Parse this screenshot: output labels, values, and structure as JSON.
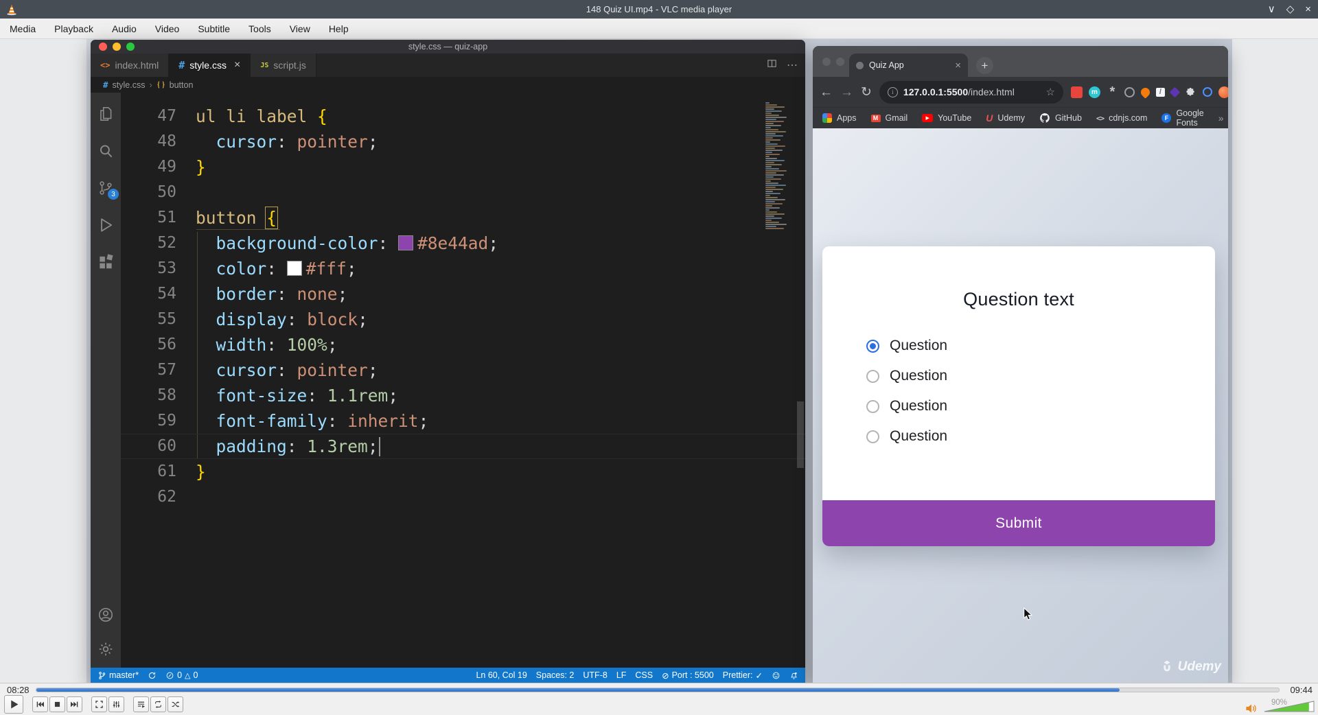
{
  "vlc": {
    "title": "148 Quiz UI.mp4 - VLC media player",
    "menu": [
      "Media",
      "Playback",
      "Audio",
      "Video",
      "Subtitle",
      "Tools",
      "View",
      "Help"
    ],
    "window_controls": [
      "minimize",
      "maximize",
      "close"
    ],
    "time_elapsed": "08:28",
    "time_total": "09:44",
    "progress_pct": 87.2,
    "volume_label": "90%",
    "volume_fill_pct": 90,
    "control_groups": [
      [
        "play"
      ],
      [
        "previous",
        "stop",
        "next"
      ],
      [
        "fullscreen",
        "equalizer"
      ],
      [
        "playlist",
        "loop",
        "shuffle"
      ]
    ]
  },
  "vscode": {
    "window_title": "style.css — quiz-app",
    "activity_bar": [
      "explorer",
      "search",
      "source-control",
      "run-debug",
      "extensions"
    ],
    "activity_bar_bottom": [
      "account",
      "settings"
    ],
    "scm_badge": "3",
    "tabs": [
      {
        "label": "index.html",
        "icon": "html",
        "active": false
      },
      {
        "label": "style.css",
        "icon": "css",
        "active": true
      },
      {
        "label": "script.js",
        "icon": "js",
        "active": false
      }
    ],
    "breadcrumb": {
      "file": "style.css",
      "symbol": "button"
    },
    "code": {
      "lines": [
        {
          "n": 47,
          "segments": [
            {
              "t": "ul li label ",
              "c": "sel"
            },
            {
              "t": "{",
              "c": "brace"
            }
          ]
        },
        {
          "n": 48,
          "segments": [
            {
              "t": "  ",
              "c": "pun"
            },
            {
              "t": "cursor",
              "c": "prop"
            },
            {
              "t": ": ",
              "c": "pun"
            },
            {
              "t": "pointer",
              "c": "val"
            },
            {
              "t": ";",
              "c": "pun"
            }
          ]
        },
        {
          "n": 49,
          "segments": [
            {
              "t": "}",
              "c": "brace"
            }
          ]
        },
        {
          "n": 50,
          "segments": []
        },
        {
          "n": 51,
          "segments": [
            {
              "t": "button ",
              "c": "sel"
            },
            {
              "t": "{",
              "c": "brace",
              "match": true
            }
          ]
        },
        {
          "n": 52,
          "segments": [
            {
              "t": "  ",
              "c": "pun"
            },
            {
              "t": "background-color",
              "c": "prop"
            },
            {
              "t": ": ",
              "c": "pun"
            },
            {
              "t": "#8e44ad",
              "c": "val",
              "swatch": "#8e44ad"
            },
            {
              "t": ";",
              "c": "pun"
            }
          ]
        },
        {
          "n": 53,
          "segments": [
            {
              "t": "  ",
              "c": "pun"
            },
            {
              "t": "color",
              "c": "prop"
            },
            {
              "t": ": ",
              "c": "pun"
            },
            {
              "t": "#fff",
              "c": "val",
              "swatch": "#ffffff"
            },
            {
              "t": ";",
              "c": "pun"
            }
          ]
        },
        {
          "n": 54,
          "segments": [
            {
              "t": "  ",
              "c": "pun"
            },
            {
              "t": "border",
              "c": "prop"
            },
            {
              "t": ": ",
              "c": "pun"
            },
            {
              "t": "none",
              "c": "val"
            },
            {
              "t": ";",
              "c": "pun"
            }
          ]
        },
        {
          "n": 55,
          "segments": [
            {
              "t": "  ",
              "c": "pun"
            },
            {
              "t": "display",
              "c": "prop"
            },
            {
              "t": ": ",
              "c": "pun"
            },
            {
              "t": "block",
              "c": "val"
            },
            {
              "t": ";",
              "c": "pun"
            }
          ]
        },
        {
          "n": 56,
          "segments": [
            {
              "t": "  ",
              "c": "pun"
            },
            {
              "t": "width",
              "c": "prop"
            },
            {
              "t": ": ",
              "c": "pun"
            },
            {
              "t": "100%",
              "c": "num"
            },
            {
              "t": ";",
              "c": "pun"
            }
          ]
        },
        {
          "n": 57,
          "segments": [
            {
              "t": "  ",
              "c": "pun"
            },
            {
              "t": "cursor",
              "c": "prop"
            },
            {
              "t": ": ",
              "c": "pun"
            },
            {
              "t": "pointer",
              "c": "val"
            },
            {
              "t": ";",
              "c": "pun"
            }
          ]
        },
        {
          "n": 58,
          "segments": [
            {
              "t": "  ",
              "c": "pun"
            },
            {
              "t": "font-size",
              "c": "prop"
            },
            {
              "t": ": ",
              "c": "pun"
            },
            {
              "t": "1.1rem",
              "c": "num"
            },
            {
              "t": ";",
              "c": "pun"
            }
          ]
        },
        {
          "n": 59,
          "segments": [
            {
              "t": "  ",
              "c": "pun"
            },
            {
              "t": "font-family",
              "c": "prop"
            },
            {
              "t": ": ",
              "c": "pun"
            },
            {
              "t": "inherit",
              "c": "val"
            },
            {
              "t": ";",
              "c": "pun"
            }
          ]
        },
        {
          "n": 60,
          "current": true,
          "segments": [
            {
              "t": "  ",
              "c": "pun"
            },
            {
              "t": "padding",
              "c": "prop"
            },
            {
              "t": ": ",
              "c": "pun"
            },
            {
              "t": "1.3rem",
              "c": "num"
            },
            {
              "t": ";",
              "c": "pun"
            }
          ]
        },
        {
          "n": 61,
          "segments": [
            {
              "t": "}",
              "c": "brace"
            }
          ]
        },
        {
          "n": 62,
          "segments": []
        }
      ]
    },
    "status": {
      "branch": "master*",
      "errors": "0",
      "warnings": "0"
    },
    "status_right": [
      {
        "name": "line-col",
        "text": "Ln 60, Col 19"
      },
      {
        "name": "indentation",
        "text": "Spaces: 2"
      },
      {
        "name": "encoding",
        "text": "UTF-8"
      },
      {
        "name": "eol",
        "text": "LF"
      },
      {
        "name": "language-mode",
        "text": "CSS"
      },
      {
        "name": "live-server-port",
        "icon": "slash-circle",
        "text": "Port : 5500"
      },
      {
        "name": "prettier",
        "text": "Prettier:",
        "icon_after": "check"
      }
    ]
  },
  "chrome": {
    "tab_title": "Quiz App",
    "url": {
      "host": "127.0.0.1:5500",
      "path": "/index.html"
    },
    "toolbar_icons": [
      "back",
      "forward",
      "reload",
      "site-info",
      "bookmark-star"
    ],
    "extension_icons": [
      "red-chart",
      "teal-m",
      "gray-flower",
      "gray-rings",
      "orange-drop",
      "white-pen",
      "purple-diamond",
      "puzzle",
      "blue-ring",
      "profile-avatar"
    ],
    "bookmarks": [
      {
        "label": "Apps",
        "icon": "apps"
      },
      {
        "label": "Gmail",
        "icon": "gmail"
      },
      {
        "label": "YouTube",
        "icon": "youtube"
      },
      {
        "label": "Udemy",
        "icon": "udemy"
      },
      {
        "label": "GitHub",
        "icon": "github"
      },
      {
        "label": "cdnjs.com",
        "icon": "cdnjs"
      },
      {
        "label": "Google Fonts",
        "icon": "google-fonts"
      }
    ],
    "bookmarks_overflow": "»",
    "quiz": {
      "question_title": "Question text",
      "options": [
        "Question",
        "Question",
        "Question",
        "Question"
      ],
      "selected_index": 0,
      "submit_label": "Submit",
      "accent_color": "#8e44ad"
    },
    "watermark": "Udemy"
  }
}
